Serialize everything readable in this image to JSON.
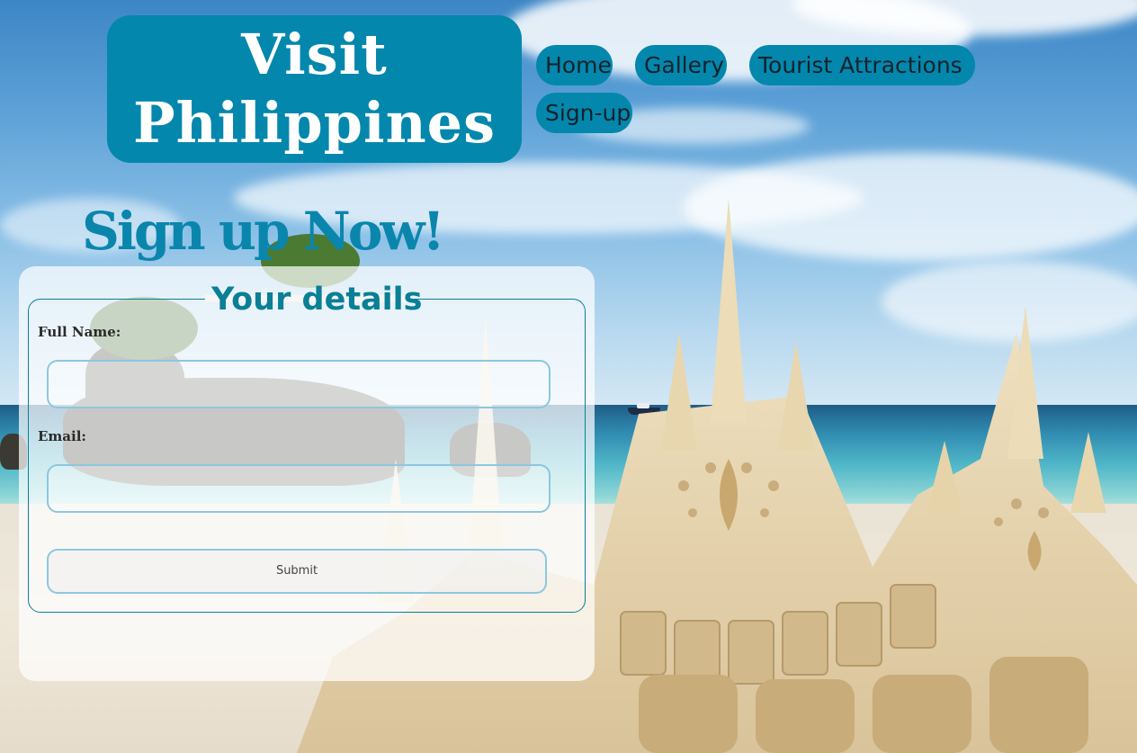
{
  "brand": {
    "line1": "Visit",
    "line2": "Philippines"
  },
  "nav": {
    "items": [
      {
        "label": "Home"
      },
      {
        "label": "Gallery"
      },
      {
        "label": "Tourist Attractions"
      },
      {
        "label": "Sign-up"
      }
    ]
  },
  "signup": {
    "title": "Sign up Now!",
    "legend": "Your details",
    "fields": [
      {
        "label": "Full Name:",
        "value": "",
        "placeholder": ""
      },
      {
        "label": "Email:",
        "value": "",
        "placeholder": ""
      }
    ],
    "submit_label": "Submit"
  },
  "colors": {
    "accent": "#0487ad",
    "title": "#0a86ad",
    "input_border": "#8cc7de"
  }
}
